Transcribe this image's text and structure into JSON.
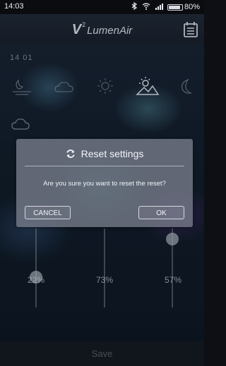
{
  "status_bar": {
    "time": "14:03",
    "battery": "80%"
  },
  "app": {
    "logo_letter": "V",
    "logo_sup": "2",
    "logo_name": "LumenAir"
  },
  "scene": {
    "clock": "14  01"
  },
  "sliders": [
    {
      "percent_label": "22%",
      "level": 0.22
    },
    {
      "percent_label": "73%",
      "level": 0.73
    },
    {
      "percent_label": "57%",
      "level": 0.57
    }
  ],
  "save_label": "Save",
  "dialog": {
    "title": "Reset settings",
    "message": "Are you sure you want to reset the reset?",
    "cancel_label": "CANCEL",
    "ok_label": "OK"
  }
}
